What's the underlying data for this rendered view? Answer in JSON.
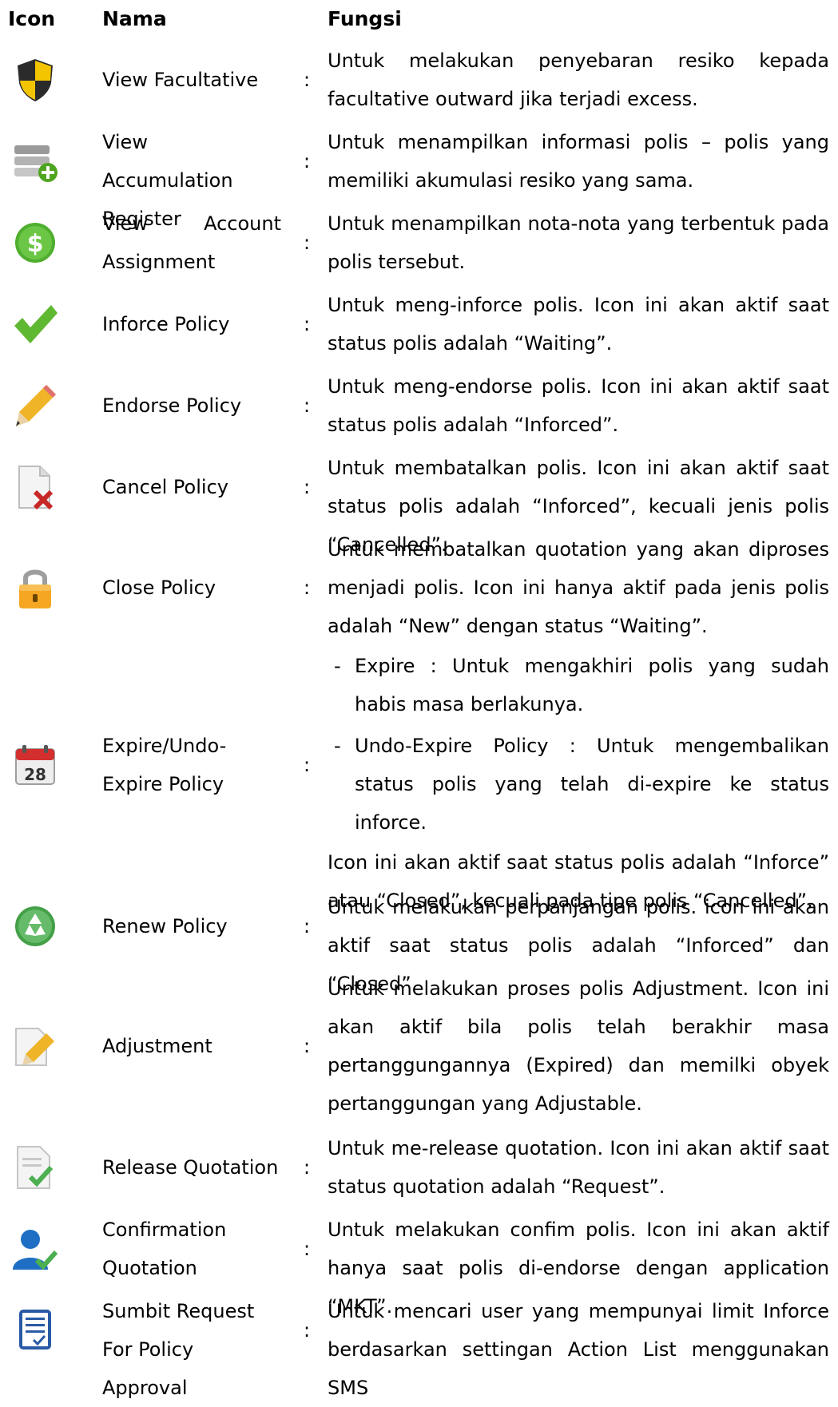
{
  "header": {
    "icon": "Icon",
    "nama": "Nama",
    "fungsi": "Fungsi"
  },
  "colon": ":",
  "rows": [
    {
      "icon": "shield-icon",
      "nama": "View Facultative",
      "fungsi": "Untuk melakukan penyebaran resiko kepada facultative outward jika terjadi excess."
    },
    {
      "icon": "database-add-icon",
      "nama": "View Accumulation Register",
      "fungsi": "Untuk menampilkan informasi polis – polis yang memiliki akumulasi resiko yang sama."
    },
    {
      "icon": "dollar-coin-icon",
      "nama": "View Account Assignment",
      "fungsi": "Untuk menampilkan nota-nota yang terbentuk pada polis tersebut."
    },
    {
      "icon": "checkmark-icon",
      "nama": "Inforce Policy",
      "fungsi": "Untuk meng-inforce polis. Icon ini akan aktif saat status polis adalah “Waiting”."
    },
    {
      "icon": "pencil-icon",
      "nama": "Endorse Policy",
      "fungsi": "Untuk meng-endorse polis. Icon ini akan aktif saat status polis adalah “Inforced”."
    },
    {
      "icon": "document-delete-icon",
      "nama": "Cancel Policy",
      "fungsi": "Untuk membatalkan polis. Icon ini akan aktif saat status polis adalah “Inforced”, kecuali jenis polis “Cancelled”."
    },
    {
      "icon": "padlock-icon",
      "nama": "Close Policy",
      "fungsi": "Untuk membatalkan quotation yang akan diproses menjadi polis. Icon ini hanya aktif pada jenis polis adalah “New” dengan status “Waiting”."
    },
    {
      "icon": "calendar-icon",
      "nama": "Expire/Undo-Expire Policy",
      "bullets": [
        "Expire : Untuk mengakhiri polis yang sudah habis masa berlakunya.",
        "Undo-Expire Policy : Untuk mengembalikan status polis yang telah di-expire ke status inforce."
      ],
      "fungsi": "Icon ini akan aktif saat status polis adalah “Inforce” atau “Closed”, kecuali pada tipe polis “Cancelled”."
    },
    {
      "icon": "recycle-icon",
      "nama": "Renew Policy",
      "fungsi": "Untuk melakukan perpanjangan polis. icon ini akan aktif saat status polis adalah “Inforced” dan “Closed”"
    },
    {
      "icon": "document-edit-icon",
      "nama": "Adjustment",
      "fungsi": "Untuk melakukan proses polis Adjustment. Icon ini akan aktif bila polis telah berakhir masa pertanggungannya (Expired) dan memilki obyek pertanggungan yang Adjustable."
    },
    {
      "icon": "document-check-icon",
      "nama": "Release Quotation",
      "fungsi": "Untuk me-release quotation. Icon ini akan aktif saat status quotation adalah “Request”."
    },
    {
      "icon": "user-check-icon",
      "nama": "Confirmation Quotation",
      "fungsi": "Untuk melakukan confim polis. Icon ini akan aktif hanya saat polis di-endorse dengan application “MKT”."
    },
    {
      "icon": "form-check-icon",
      "nama": "Sumbit Request For Policy Approval",
      "fungsi": "Untuk mencari user yang mempunyai limit Inforce berdasarkan settingan Action List menggunakan SMS"
    }
  ]
}
